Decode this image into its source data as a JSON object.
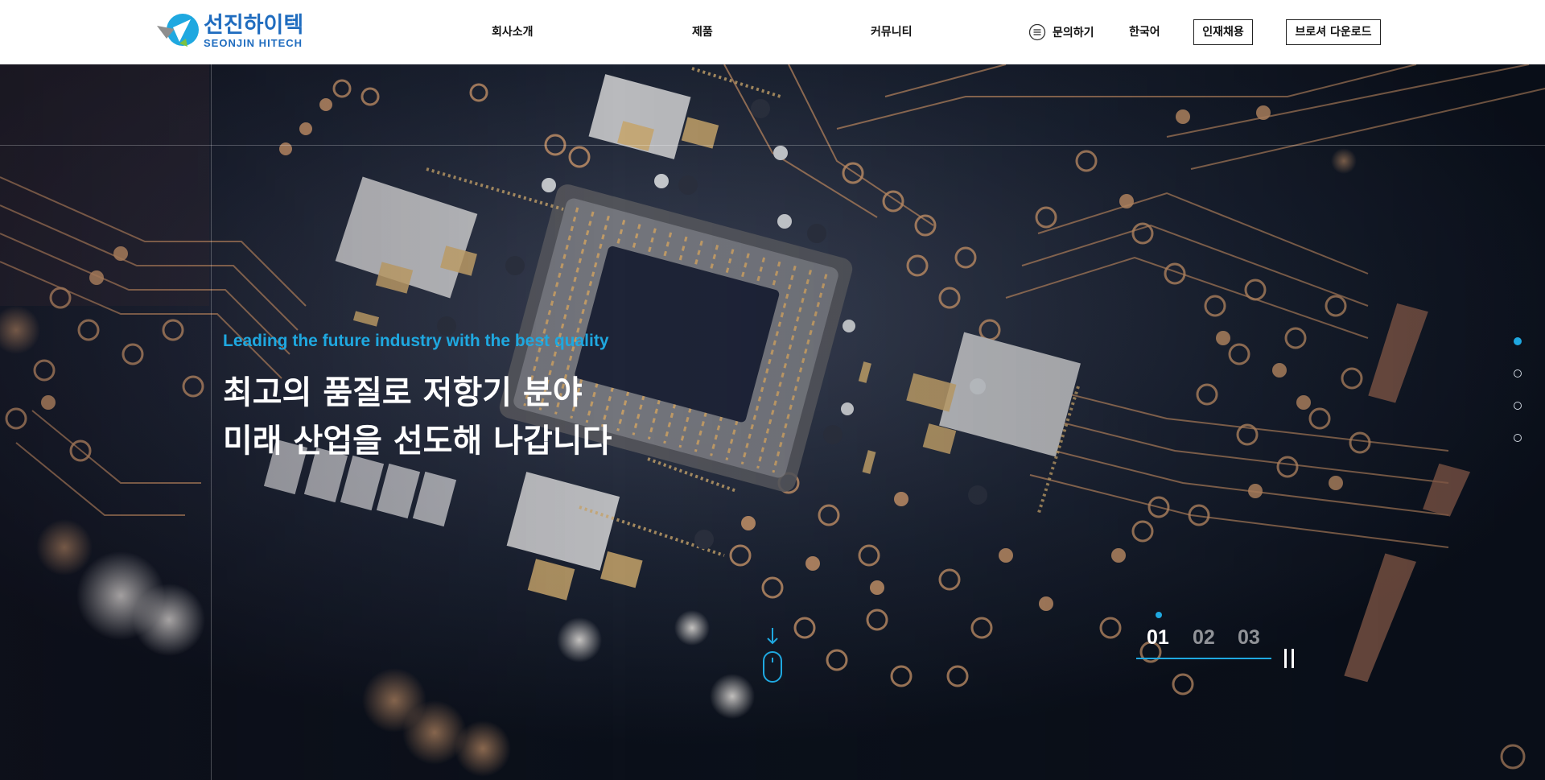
{
  "header": {
    "logo": {
      "name_ko": "선진하이텍",
      "name_en": "SEONJIN HITECH"
    },
    "nav": [
      {
        "label": "회사소개"
      },
      {
        "label": "제품"
      },
      {
        "label": "커뮤니티"
      }
    ],
    "inquiry": {
      "label": "문의하기",
      "icon": "menu-lines-icon"
    },
    "language": {
      "label": "한국어"
    },
    "recruit_button": {
      "label": "인재채용"
    },
    "brochure_button": {
      "label": "브로셔 다운로드"
    }
  },
  "hero": {
    "subtitle": "Leading the future industry with the best quality",
    "title_line1": "최고의 품질로 저항기 분야",
    "title_line2": "미래 산업을 선도해 나갑니다",
    "background": "circuit-board-chip-image",
    "scroll_indicator": {
      "icon": "mouse-scroll-icon",
      "arrow": "arrow-down-icon"
    },
    "pagination": {
      "slides": [
        "01",
        "02",
        "03"
      ],
      "active_index": 0,
      "pause_icon": "pause-icon"
    },
    "side_dots": {
      "count": 4,
      "active_index": 0
    }
  },
  "colors": {
    "accent": "#1fa8e0",
    "brand_blue": "#1f6cbf",
    "header_bg": "#ffffff",
    "hero_text": "#ffffff"
  }
}
